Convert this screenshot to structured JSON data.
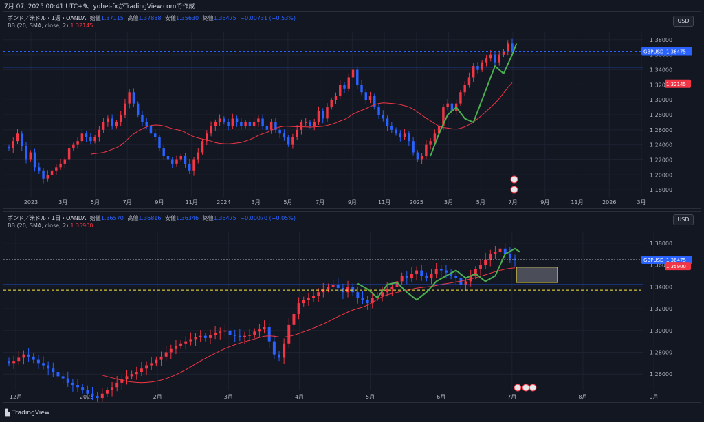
{
  "title_bar": "7月 07, 2025 00:41 UTC+9、yohei-fxがTradingView.comで作成",
  "footer": {
    "brand": "TradingView"
  },
  "colors": {
    "bg": "#131722",
    "up": "#f23645",
    "down": "#2962ff",
    "bb": "#f23645",
    "green": "#4caf50",
    "axis": "#b2b5be",
    "grid": "#1e2230"
  },
  "panes": [
    {
      "symbol": "ポンド／米ドル・1週・OANDA",
      "ohlc": [
        {
          "label": "始値",
          "value": "1.37115"
        },
        {
          "label": "高値",
          "value": "1.37888"
        },
        {
          "label": "安値",
          "value": "1.35630"
        },
        {
          "label": "終値",
          "value": "1.36475"
        }
      ],
      "change": "−0.00731 (−0.53%)",
      "bb_label": "BB (20, SMA, close, 2)",
      "bb_value": "1.32145",
      "currency": "USD",
      "price_tag_label": "GBPUSD",
      "price_tag_value": "1.36475",
      "bb_tag_value": "1.32145",
      "yticks": [
        "1.38000",
        "1.36000",
        "1.34000",
        "1.32000",
        "1.30000",
        "1.28000",
        "1.26000",
        "1.24000",
        "1.22000",
        "1.20000",
        "1.18000"
      ],
      "xticks": [
        "2023",
        "3月",
        "5月",
        "7月",
        "9月",
        "11月",
        "2024",
        "3月",
        "5月",
        "7月",
        "9月",
        "11月",
        "2025",
        "3月",
        "5月",
        "7月",
        "9月",
        "11月",
        "2026",
        "3月"
      ]
    },
    {
      "symbol": "ポンド／米ドル・1日・OANDA",
      "ohlc": [
        {
          "label": "始値",
          "value": "1.36570"
        },
        {
          "label": "高値",
          "value": "1.36816"
        },
        {
          "label": "安値",
          "value": "1.36346"
        },
        {
          "label": "終値",
          "value": "1.36475"
        }
      ],
      "change": "−0.00070 (−0.05%)",
      "bb_label": "BB (20, SMA, close, 2)",
      "bb_value": "1.35900",
      "currency": "USD",
      "price_tag_label": "GBPUSD",
      "price_tag_value": "1.36475",
      "bb_tag_value": "1.35900",
      "yticks": [
        "1.38000",
        "1.36000",
        "1.34000",
        "1.32000",
        "1.30000",
        "1.28000",
        "1.26000"
      ],
      "xticks": [
        "12月",
        "2025",
        "2月",
        "3月",
        "4月",
        "5月",
        "6月",
        "7月",
        "8月",
        "9月"
      ]
    }
  ],
  "chart_data": [
    {
      "type": "candlestick",
      "title": "ポンド／米ドル・1週・OANDA",
      "ylim": [
        1.17,
        1.39
      ],
      "closes": [
        1.235,
        1.245,
        1.255,
        1.238,
        1.22,
        1.23,
        1.21,
        1.205,
        1.195,
        1.2,
        1.205,
        1.21,
        1.215,
        1.22,
        1.235,
        1.24,
        1.245,
        1.255,
        1.25,
        1.245,
        1.25,
        1.26,
        1.27,
        1.275,
        1.265,
        1.27,
        1.28,
        1.295,
        1.31,
        1.295,
        1.28,
        1.27,
        1.265,
        1.255,
        1.25,
        1.235,
        1.225,
        1.22,
        1.215,
        1.22,
        1.225,
        1.215,
        1.205,
        1.22,
        1.23,
        1.245,
        1.255,
        1.265,
        1.27,
        1.275,
        1.27,
        1.265,
        1.275,
        1.27,
        1.265,
        1.27,
        1.265,
        1.27,
        1.275,
        1.265,
        1.26,
        1.27,
        1.26,
        1.255,
        1.25,
        1.24,
        1.25,
        1.26,
        1.27,
        1.27,
        1.265,
        1.27,
        1.285,
        1.275,
        1.29,
        1.3,
        1.305,
        1.32,
        1.315,
        1.33,
        1.34,
        1.32,
        1.31,
        1.3,
        1.305,
        1.29,
        1.28,
        1.275,
        1.265,
        1.26,
        1.255,
        1.25,
        1.255,
        1.245,
        1.23,
        1.22,
        1.225,
        1.24,
        1.245,
        1.255,
        1.265,
        1.29,
        1.295,
        1.285,
        1.295,
        1.31,
        1.32,
        1.33,
        1.345,
        1.34,
        1.35,
        1.355,
        1.36,
        1.35,
        1.36,
        1.365,
        1.375,
        1.3648
      ],
      "bb_basis": "20-period SMA",
      "annotations": [
        "green hand-drawn wave projection"
      ]
    },
    {
      "type": "candlestick",
      "title": "ポンド／米ドル・1日・OANDA",
      "ylim": [
        1.245,
        1.39
      ],
      "closes": [
        1.27,
        1.272,
        1.275,
        1.278,
        1.276,
        1.273,
        1.27,
        1.268,
        1.265,
        1.262,
        1.258,
        1.256,
        1.252,
        1.25,
        1.248,
        1.245,
        1.242,
        1.24,
        1.238,
        1.242,
        1.245,
        1.248,
        1.252,
        1.255,
        1.258,
        1.26,
        1.262,
        1.265,
        1.268,
        1.27,
        1.273,
        1.276,
        1.28,
        1.283,
        1.286,
        1.288,
        1.29,
        1.292,
        1.294,
        1.295,
        1.293,
        1.296,
        1.298,
        1.299,
        1.3,
        1.296,
        1.295,
        1.294,
        1.295,
        1.296,
        1.299,
        1.301,
        1.303,
        1.29,
        1.278,
        1.275,
        1.288,
        1.305,
        1.315,
        1.325,
        1.328,
        1.33,
        1.332,
        1.335,
        1.338,
        1.34,
        1.342,
        1.339,
        1.335,
        1.34,
        1.335,
        1.33,
        1.328,
        1.325,
        1.33,
        1.332,
        1.335,
        1.338,
        1.34,
        1.345,
        1.35,
        1.348,
        1.352,
        1.355,
        1.35,
        1.348,
        1.352,
        1.356,
        1.355,
        1.353,
        1.35,
        1.348,
        1.342,
        1.345,
        1.35,
        1.356,
        1.36,
        1.365,
        1.37,
        1.372,
        1.375,
        1.37,
        1.3657,
        1.3648
      ],
      "bb_basis": "20-period SMA",
      "annotations": [
        "green hand-drawn wave projection",
        "yellow highlighted box"
      ]
    }
  ]
}
